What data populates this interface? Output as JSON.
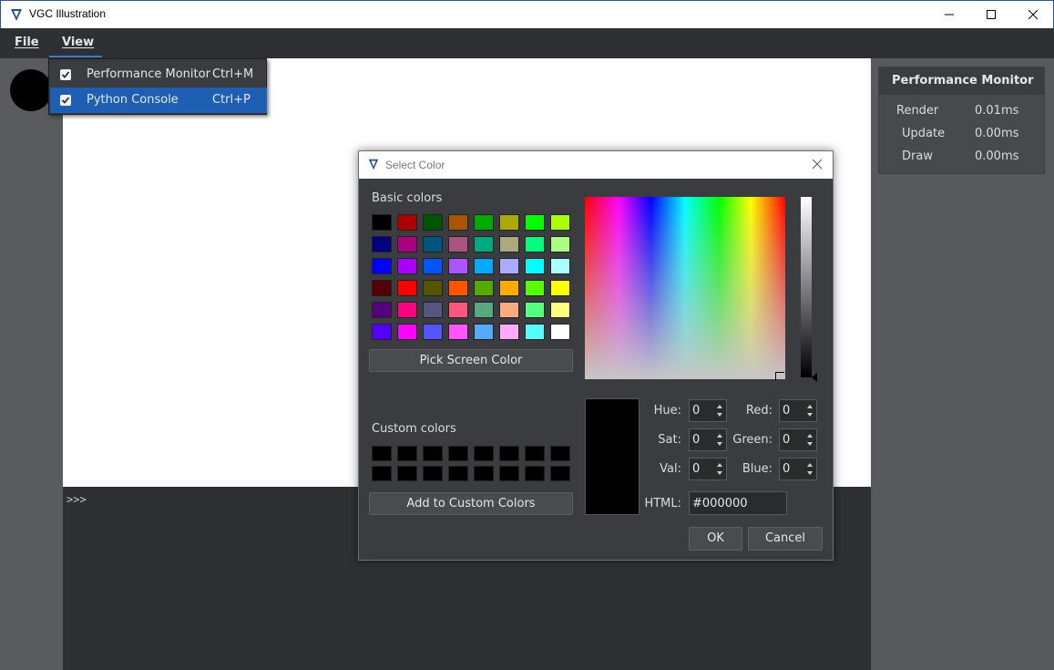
{
  "window": {
    "title": "VGC Illustration"
  },
  "menubar": {
    "file": "File",
    "view": "View"
  },
  "view_menu": {
    "items": [
      {
        "label": "Performance Monitor",
        "shortcut": "Ctrl+M",
        "checked": true
      },
      {
        "label": "Python Console",
        "shortcut": "Ctrl+P",
        "checked": true
      }
    ]
  },
  "console": {
    "prompt": ">>>"
  },
  "perf": {
    "title": "Performance Monitor",
    "rows": [
      {
        "label": "Render",
        "value": "0.01ms"
      },
      {
        "label": "Update",
        "value": "0.00ms"
      },
      {
        "label": "Draw",
        "value": "0.00ms"
      }
    ]
  },
  "dialog": {
    "title": "Select Color",
    "basic_colors_label": "Basic colors",
    "custom_colors_label": "Custom colors",
    "pick_screen": "Pick Screen Color",
    "add_custom": "Add to Custom Colors",
    "ok": "OK",
    "cancel": "Cancel",
    "hue_label": "Hue:",
    "hue": "0",
    "sat_label": "Sat:",
    "sat": "0",
    "val_label": "Val:",
    "val": "0",
    "red_label": "Red:",
    "red": "0",
    "green_label": "Green:",
    "green": "0",
    "blue_label": "Blue:",
    "blue": "0",
    "html_label": "HTML:",
    "html": "#000000",
    "basic_colors": [
      [
        "#000000",
        "#aa0000",
        "#005500",
        "#aa5500",
        "#00aa00",
        "#aaaa00",
        "#00ff00",
        "#aaff00"
      ],
      [
        "#00007f",
        "#aa007f",
        "#00557f",
        "#aa557f",
        "#00aa7f",
        "#aaaa7f",
        "#00ff7f",
        "#aaff7f"
      ],
      [
        "#0000ff",
        "#aa00ff",
        "#0055ff",
        "#aa55ff",
        "#00aaff",
        "#aaaaff",
        "#00ffff",
        "#aaffff"
      ],
      [
        "#550000",
        "#ff0000",
        "#555500",
        "#ff5500",
        "#55aa00",
        "#ffaa00",
        "#55ff00",
        "#ffff00"
      ],
      [
        "#55007f",
        "#ff007f",
        "#55557f",
        "#ff557f",
        "#55aa7f",
        "#ffaa7f",
        "#55ff7f",
        "#ffff7f"
      ],
      [
        "#5500ff",
        "#ff00ff",
        "#5555ff",
        "#ff55ff",
        "#55aaff",
        "#ffaaff",
        "#55ffff",
        "#ffffff"
      ]
    ],
    "current_color": "#000000"
  }
}
